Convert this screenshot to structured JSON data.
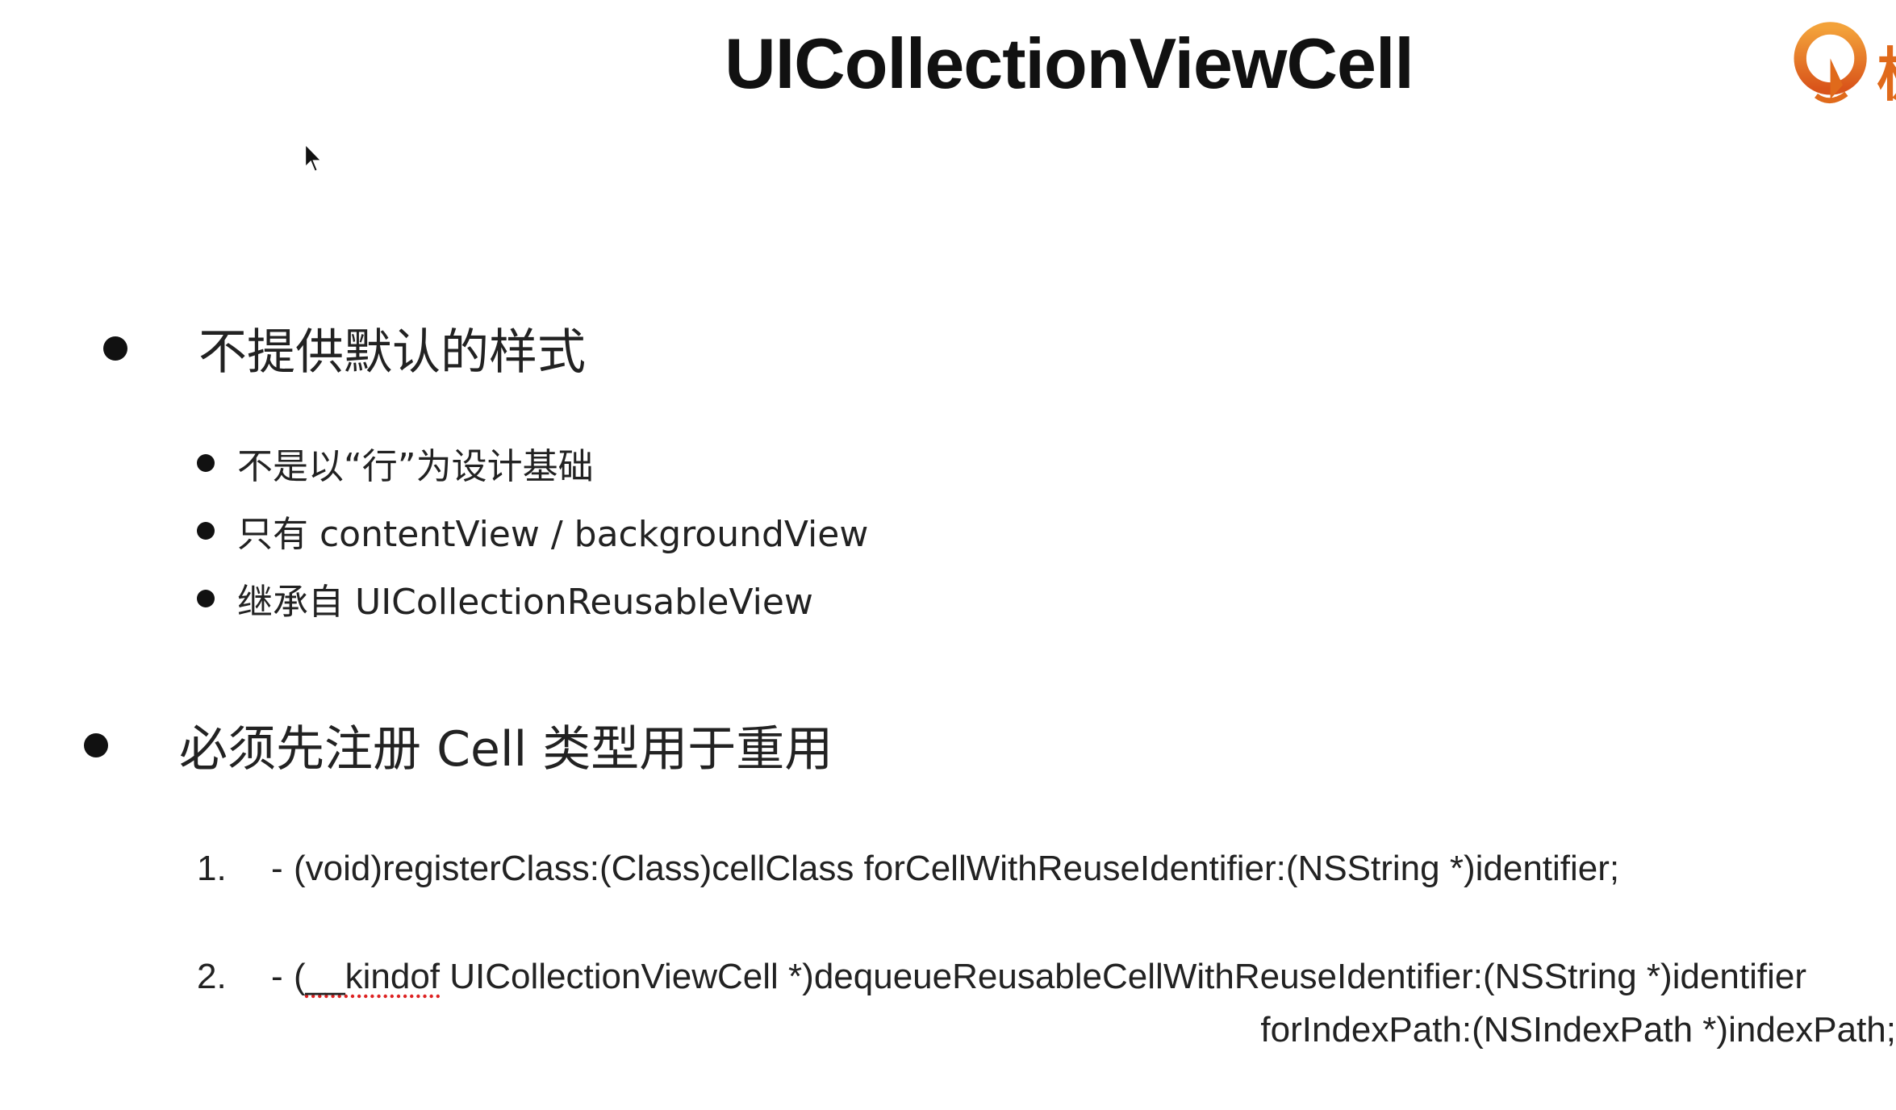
{
  "slide": {
    "title": "UICollectionViewCell",
    "logo_text": "极",
    "bullets": [
      {
        "text": "不提供默认的样式",
        "sub_items": [
          "不是以“行”为设计基础",
          "只有 contentView / backgroundView",
          "继承自 UICollectionReusableView"
        ]
      },
      {
        "text": "必须先注册 Cell 类型用于重用"
      }
    ],
    "methods": [
      {
        "number": "1.",
        "dash": "-",
        "line1": "(void)registerClass:(Class)cellClass forCellWithReuseIdentifier:(NSString *)identifier;"
      },
      {
        "number": "2.",
        "dash": "-",
        "line1_prefix": "(",
        "line1_keyword": "__kindof",
        "line1_rest": " UICollectionViewCell *)dequeueReusableCellWithReuseIdentifier:(NSString *)identifier",
        "line2": "forIndexPath:(NSIndexPath *)indexPath;"
      }
    ]
  },
  "colors": {
    "background": "#ffffff",
    "text": "#222222",
    "logo_accent": "#e06a1b"
  },
  "icons": {
    "logo": "orange-q-logo-icon",
    "cursor": "mouse-pointer-icon"
  }
}
